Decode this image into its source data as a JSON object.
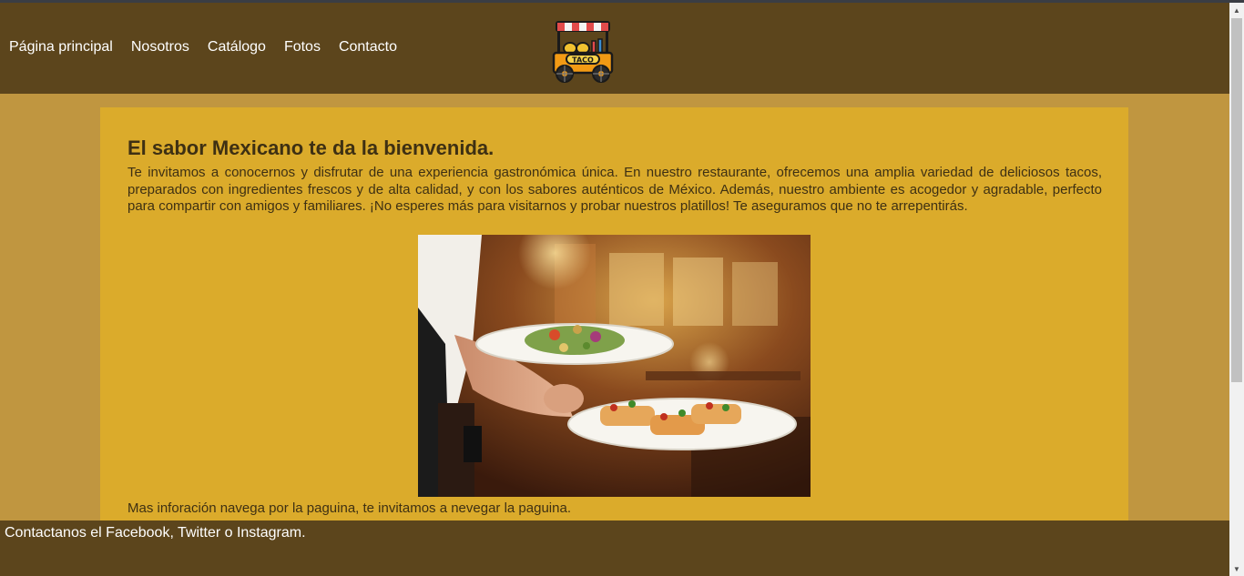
{
  "nav": {
    "items": [
      {
        "label": "Página principal"
      },
      {
        "label": "Nosotros"
      },
      {
        "label": "Catálogo"
      },
      {
        "label": "Fotos"
      },
      {
        "label": "Contacto"
      }
    ]
  },
  "logo": {
    "text": "TACO"
  },
  "main": {
    "title": "El sabor Mexicano te da la bienvenida.",
    "intro": "Te invitamos a conocernos y disfrutar de una experiencia gastronómica única. En nuestro restaurante, ofrecemos una amplia variedad de deliciosos tacos, preparados con ingredientes frescos y de alta calidad, y con los sabores auténticos de México. Además, nuestro ambiente es acogedor y agradable, perfecto para compartir con amigos y familiares. ¡No esperes más para visitarnos y probar nuestros platillos! Te aseguramos que no te arrepentirás.",
    "more": "Mas inforación navega por la paguina, te invitamos a nevegar la paguina."
  },
  "footer": {
    "text": "Contactanos el Facebook, Twitter o Instagram."
  },
  "colors": {
    "header_bg": "#5c451c",
    "page_bg": "#c09640",
    "content_bg": "#dbab2b",
    "text": "#3e3013"
  }
}
